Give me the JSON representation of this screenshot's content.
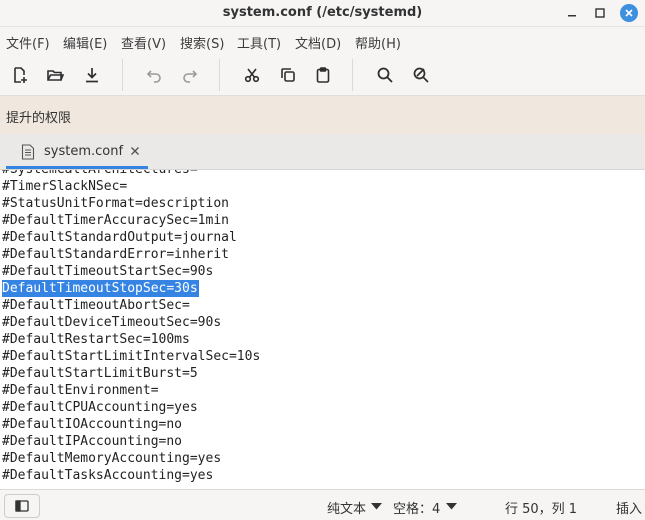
{
  "window": {
    "title": "system.conf (/etc/systemd)"
  },
  "menu": {
    "items": [
      "文件(F)",
      "编辑(E)",
      "查看(V)",
      "搜索(S)",
      "工具(T)",
      "文档(D)",
      "帮助(H)"
    ]
  },
  "toolbar": {
    "buttons": [
      "new-document",
      "open",
      "save",
      "undo",
      "redo",
      "cut",
      "copy",
      "paste",
      "find",
      "find-replace"
    ]
  },
  "infobar": {
    "label": "提升的权限"
  },
  "tab": {
    "label": "system.conf"
  },
  "editor": {
    "top_partial": "#SystemCallArchitectures=",
    "lines": [
      "#TimerSlackNSec=",
      "#StatusUnitFormat=description",
      "#DefaultTimerAccuracySec=1min",
      "#DefaultStandardOutput=journal",
      "#DefaultStandardError=inherit",
      "#DefaultTimeoutStartSec=90s",
      "DefaultTimeoutStopSec=30s",
      "#DefaultTimeoutAbortSec=",
      "#DefaultDeviceTimeoutSec=90s",
      "#DefaultRestartSec=100ms",
      "#DefaultStartLimitIntervalSec=10s",
      "#DefaultStartLimitBurst=5",
      "#DefaultEnvironment=",
      "#DefaultCPUAccounting=yes",
      "#DefaultIOAccounting=no",
      "#DefaultIPAccounting=no",
      "#DefaultMemoryAccounting=yes",
      "#DefaultTasksAccounting=yes"
    ],
    "selected_line_index": 6
  },
  "status": {
    "language": "纯文本",
    "spaces": "空格：4",
    "position": "行 50，列 1",
    "mode": "插入"
  },
  "colors": {
    "accent": "#3584e4",
    "close_button": "#3d8fe0",
    "infobar_bg": "#f0e8de"
  }
}
